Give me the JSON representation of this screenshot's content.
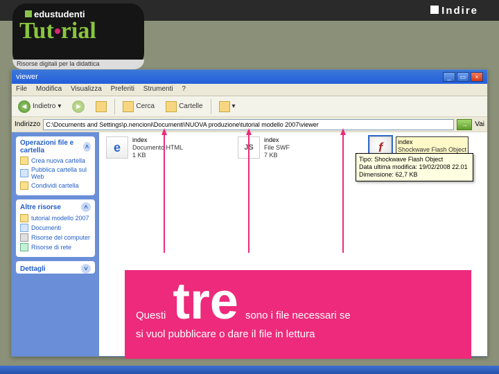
{
  "topbar": {
    "brand": "Indire"
  },
  "logo": {
    "brand": "edustudenti",
    "word_pre": "Tut",
    "word_post": "rial",
    "subtitle": "Risorse digitali per la didattica"
  },
  "window": {
    "title": "viewer",
    "menu": {
      "file": "File",
      "edit": "Modifica",
      "view": "Visualizza",
      "fav": "Preferiti",
      "tools": "Strumenti",
      "help": "?"
    },
    "toolbar": {
      "back": "Indietro",
      "search": "Cerca",
      "folders": "Cartelle"
    },
    "address": {
      "label": "Indirizzo",
      "value": "C:\\Documents and Settings\\p.nencioni\\Documenti\\NUOVA produzione\\tutorial modello 2007\\viewer",
      "go": "Vai"
    }
  },
  "sidebar": {
    "panels": [
      {
        "title": "Operazioni file e cartella",
        "items": [
          {
            "label": "Crea nuova cartella"
          },
          {
            "label": "Pubblica cartella sul Web"
          },
          {
            "label": "Condividi cartella"
          }
        ]
      },
      {
        "title": "Altre risorse",
        "items": [
          {
            "label": "tutorial modello 2007"
          },
          {
            "label": "Documenti"
          },
          {
            "label": "Risorse del computer"
          },
          {
            "label": "Risorse di rete"
          }
        ]
      },
      {
        "title": "Dettagli",
        "items": []
      }
    ]
  },
  "files": [
    {
      "name": "index",
      "type": "Documento HTML",
      "size": "1 KB"
    },
    {
      "name": "index",
      "type": "File SWF",
      "size": "7 KB"
    },
    {
      "name": "index",
      "type": "Shockwave Flash Object",
      "size": "63 KB"
    }
  ],
  "tooltip": {
    "l1": "Tipo: Shockwave Flash Object",
    "l2": "Data ultima modifica: 19/02/2008 22.01",
    "l3": "Dimensione: 62,7 KB"
  },
  "callout": {
    "pre": "Questi",
    "big": "tre",
    "post": "sono i file necessari se",
    "line2": "si vuol pubblicare o dare il file in lettura"
  }
}
